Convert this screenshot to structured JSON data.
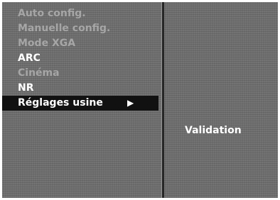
{
  "menu": {
    "items": [
      {
        "label": "Auto config.",
        "enabled": false
      },
      {
        "label": "Manuelle config.",
        "enabled": false
      },
      {
        "label": "Mode XGA",
        "enabled": false
      },
      {
        "label": "ARC",
        "enabled": true
      },
      {
        "label": "Cinéma",
        "enabled": false
      },
      {
        "label": "NR",
        "enabled": true
      },
      {
        "label": "Réglages usine",
        "enabled": true,
        "selected": true,
        "icon": "play-arrow-icon",
        "arrow": "▶"
      }
    ]
  },
  "submenu": {
    "label": "Validation"
  },
  "colors": {
    "panel": "#6f6f6f",
    "highlight": "#111111",
    "text_enabled": "#ffffff",
    "text_disabled": "#a6a6a6"
  }
}
